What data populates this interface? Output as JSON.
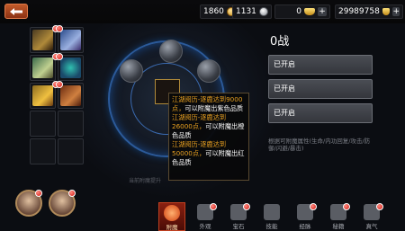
{
  "topbar": {
    "gold_amount": "1860",
    "silver_amount": "1131",
    "ingot_amount": "0",
    "copper_amount": "29989758"
  },
  "power": {
    "label": "0战"
  },
  "options": [
    {
      "label": "已开启"
    },
    {
      "label": "已开启"
    },
    {
      "label": "已开启"
    }
  ],
  "desc": "根据可附魔属性(生命/内功回复/攻击/防御/闪避/暴击)",
  "center_hint": "当前附魔提升",
  "tooltip": {
    "lines": [
      {
        "title": "江湖阅历-逐鹿达到9000点，",
        "body": "可以附魔出紫色品质"
      },
      {
        "title": "江湖阅历-逐鹿达到26000点，",
        "body": "可以附魔出橙色品质"
      },
      {
        "title": "江湖阅历-逐鹿达到50000点，",
        "body": "可以附魔出红色品质"
      }
    ]
  },
  "tabs": [
    {
      "label": "附魔",
      "icon": "enchant-icon",
      "active": true
    },
    {
      "label": "外观",
      "icon": "appearance-icon",
      "active": false
    },
    {
      "label": "宝石",
      "icon": "gem-icon",
      "active": false
    },
    {
      "label": "技能",
      "icon": "skill-icon",
      "active": false
    },
    {
      "label": "经脉",
      "icon": "meridian-icon",
      "active": false
    },
    {
      "label": "秘籍",
      "icon": "manual-icon",
      "active": false
    },
    {
      "label": "真气",
      "icon": "qi-icon",
      "active": false
    }
  ],
  "colors": {
    "accent": "#c25a2a",
    "tooltip_title": "#e8a020",
    "button_bg": "#4a4d54"
  }
}
